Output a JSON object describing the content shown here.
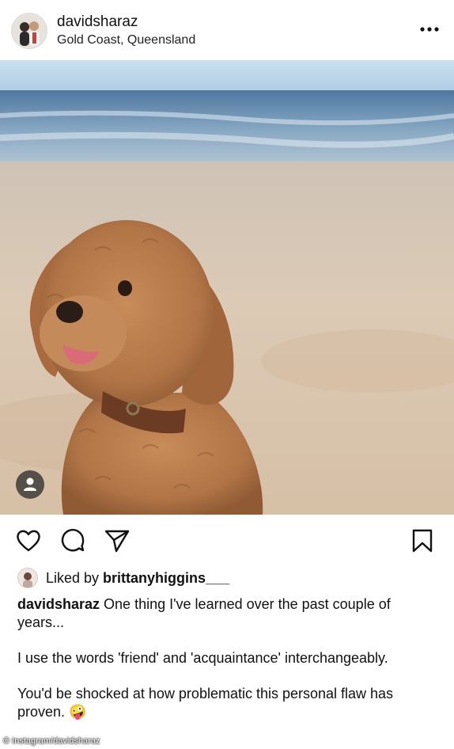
{
  "header": {
    "username": "davidsharaz",
    "location": "Gold Coast, Queensland",
    "more_icon": "more-horizontal-icon"
  },
  "post": {
    "photo_subject": "",
    "user_tag_icon": "person-icon"
  },
  "actions": {
    "like_icon": "heart-icon",
    "comment_icon": "comment-bubble-icon",
    "share_icon": "paper-plane-icon",
    "save_icon": "bookmark-icon"
  },
  "likes": {
    "prefix": "Liked by ",
    "liker": "brittanyhiggins___"
  },
  "caption": {
    "username": "davidsharaz",
    "line1": " One thing I've learned over the past couple of years...",
    "line2": "I use the words 'friend' and 'acquaintance' interchangeably.",
    "line3": "You'd be shocked at how problematic this personal flaw has proven. 🤪"
  },
  "watermark": "© Instagram/davidsharaz",
  "colors": {
    "sky": "#bcd6ea",
    "ocean": "#6f93b5",
    "sand": "#d8c8b5",
    "dog": "#b47a4c"
  }
}
